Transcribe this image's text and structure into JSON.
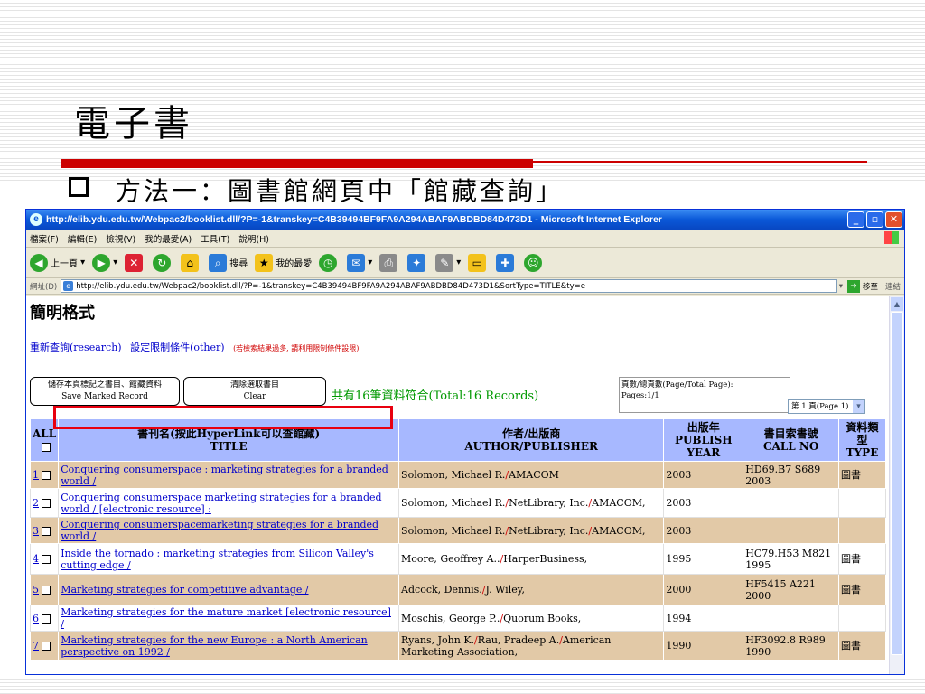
{
  "slide": {
    "title": "電子書",
    "bullet": "方法一：圖書館網頁中「館藏查詢」"
  },
  "window": {
    "title": "http://elib.ydu.edu.tw/Webpac2/booklist.dll/?P=-1&transkey=C4B39494BF9FA9A294ABAF9ABDBD84D473D1 - Microsoft Internet Explorer",
    "menu": [
      "檔案(F)",
      "編輯(E)",
      "檢視(V)",
      "我的最愛(A)",
      "工具(T)",
      "說明(H)"
    ],
    "toolbar": {
      "back": "上一頁",
      "search": "搜尋",
      "favorites": "我的最愛"
    },
    "address_label": "網址(D)",
    "address_value": "http://elib.ydu.edu.tw/Webpac2/booklist.dll/?P=-1&transkey=C4B39494BF9FA9A294ABAF9ABDBD84D473D1&SortType=TITLE&ty=e",
    "go_label": "移至",
    "links_label": "連結"
  },
  "page": {
    "heading": "簡明格式",
    "link_research": "重新查詢(research)",
    "link_other": "設定限制條件(other)",
    "hint": "(若檢索結果過多, 請利用限制條件設限)",
    "btn_save_line1": "儲存本頁標記之書目、館藏資料",
    "btn_save_line2": "Save Marked Record",
    "btn_clear_line1": "清除選取書目",
    "btn_clear_line2": "Clear",
    "total": "共有16筆資料符合(Total:16 Records)",
    "pageinfo_line1": "頁數/總頁數(Page/Total Page):",
    "pageinfo_line2": "Pages:1/1",
    "page_select": "第 1 頁(Page 1)"
  },
  "table": {
    "headers": {
      "all": "ALL",
      "title_zh": "書刊名(按此HyperLink可以查館藏)",
      "title_en": "TITLE",
      "author_zh": "作者/出版商",
      "author_en": "AUTHOR/PUBLISHER",
      "year_zh": "出版年",
      "year_en1": "PUBLISH",
      "year_en2": "YEAR",
      "call_zh": "書目索書號",
      "call_en": "CALL NO",
      "type_zh1": "資料類",
      "type_zh2": "型",
      "type_en": "TYPE"
    },
    "rows": [
      {
        "num": "1",
        "title": "Conquering consumerspace : marketing strategies for a branded world /",
        "author": "Solomon, Michael R.",
        "publisher": "AMACOM",
        "year": "2003",
        "call": "HD69.B7 S689 2003",
        "type": "圖書"
      },
      {
        "num": "2",
        "title": "Conquering consumerspace marketing strategies for a branded world / [electronic resource] :",
        "author": "Solomon, Michael R.",
        "publisher": "NetLibrary, Inc.",
        "publisher2": "AMACOM,",
        "year": "2003",
        "call": "",
        "type": ""
      },
      {
        "num": "3",
        "title": "Conquering consumerspacemarketing strategies for a branded world /",
        "author": "Solomon, Michael R.",
        "publisher": "NetLibrary, Inc.",
        "publisher2": "AMACOM,",
        "year": "2003",
        "call": "",
        "type": ""
      },
      {
        "num": "4",
        "title": "Inside the tornado : marketing strategies from Silicon Valley's cutting edge /",
        "author": "Moore, Geoffrey A..",
        "publisher": "HarperBusiness,",
        "year": "1995",
        "call": "HC79.H53 M821 1995",
        "type": "圖書"
      },
      {
        "num": "5",
        "title": "Marketing strategies for competitive advantage /",
        "author": "Adcock, Dennis.",
        "publisher": "J. Wiley,",
        "year": "2000",
        "call": "HF5415 A221 2000",
        "type": "圖書"
      },
      {
        "num": "6",
        "title": "Marketing strategies for the mature market [electronic resource] /",
        "author": "Moschis, George P..",
        "publisher": "Quorum Books,",
        "year": "1994",
        "call": "",
        "type": ""
      },
      {
        "num": "7",
        "title": "Marketing strategies for the new Europe : a North American perspective on 1992 /",
        "author": "Ryans, John K.",
        "publisher": "Rau, Pradeep A.",
        "publisher2": "American Marketing Association,",
        "year": "1990",
        "call": "HF3092.8 R989 1990",
        "type": "圖書"
      }
    ]
  }
}
